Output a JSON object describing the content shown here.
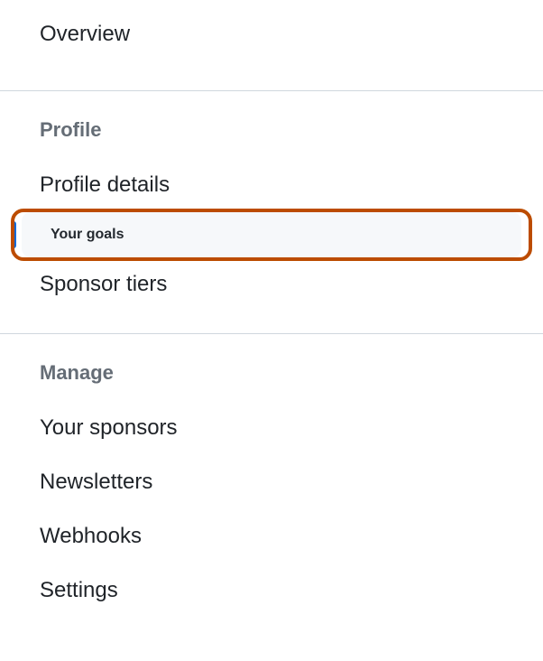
{
  "sections": [
    {
      "items": [
        {
          "label": "Overview"
        }
      ]
    },
    {
      "header": "Profile",
      "items": [
        {
          "label": "Profile details"
        },
        {
          "label": "Your goals",
          "selected": true,
          "highlighted": true
        },
        {
          "label": "Sponsor tiers"
        }
      ]
    },
    {
      "header": "Manage",
      "items": [
        {
          "label": "Your sponsors"
        },
        {
          "label": "Newsletters"
        },
        {
          "label": "Webhooks"
        },
        {
          "label": "Settings"
        }
      ]
    }
  ]
}
